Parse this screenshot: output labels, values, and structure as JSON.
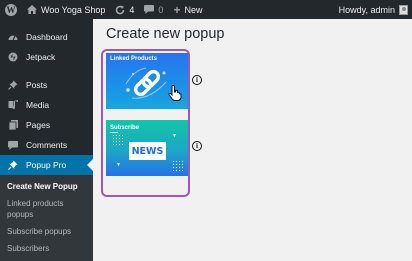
{
  "adminbar": {
    "wp_logo": "W",
    "site_name": "Woo Yoga Shop",
    "updates_count": "4",
    "comments_count": "0",
    "new_label": "New",
    "greeting": "Howdy, admin",
    "icons": [
      "wordpress-icon",
      "home-icon",
      "refresh-icon",
      "comment-icon",
      "plus-icon",
      "avatar"
    ]
  },
  "sidebar": {
    "items": [
      {
        "label": "Dashboard",
        "icon": "dashboard-icon"
      },
      {
        "label": "Jetpack",
        "icon": "jetpack-icon"
      },
      {
        "label": "Posts",
        "icon": "pin-icon"
      },
      {
        "label": "Media",
        "icon": "media-icon"
      },
      {
        "label": "Pages",
        "icon": "pages-icon"
      },
      {
        "label": "Comments",
        "icon": "comment-icon"
      },
      {
        "label": "Popup Pro",
        "icon": "pin-icon",
        "active": true
      }
    ],
    "submenu": [
      {
        "label": "Create New Popup",
        "current": true
      },
      {
        "label": "Linked products popups"
      },
      {
        "label": "Subscribe popups"
      },
      {
        "label": "Subscribers"
      }
    ]
  },
  "main": {
    "title": "Create new popup",
    "cards": [
      {
        "label": "Linked Products"
      },
      {
        "label": "Subscribe",
        "badge": "NEWS"
      }
    ],
    "info_glyph": "i",
    "colors": {
      "highlight": "#9b59b6",
      "active_menu": "#0073aa",
      "adminbar": "#23282d"
    }
  }
}
